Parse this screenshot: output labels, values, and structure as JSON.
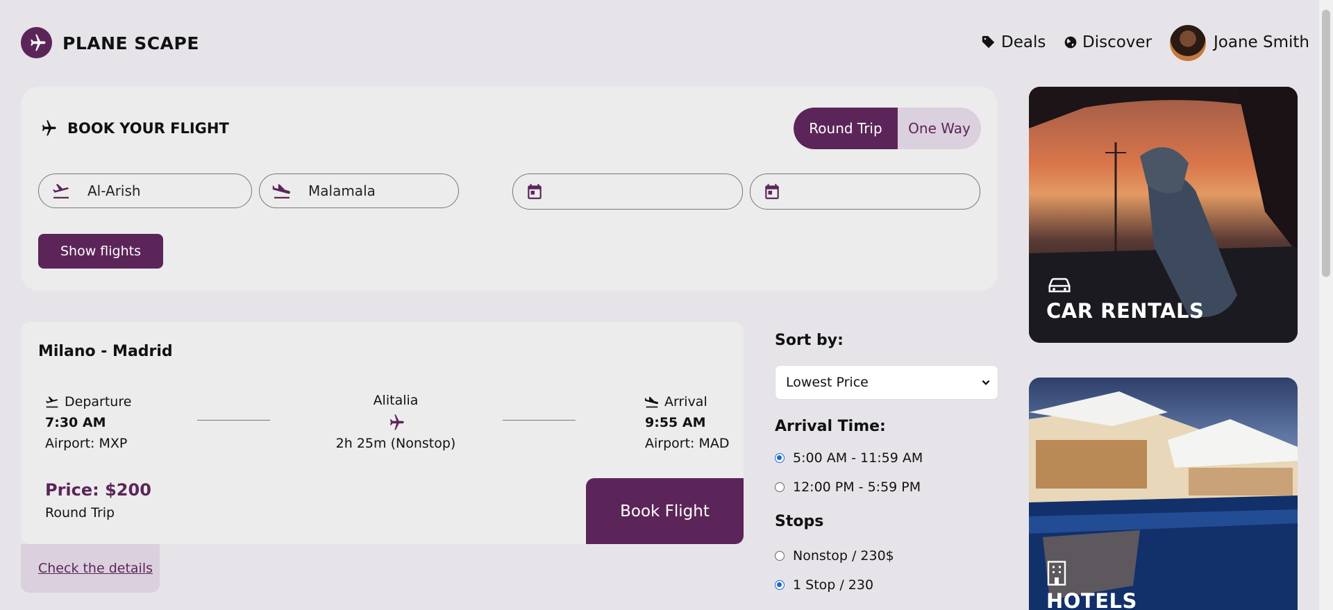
{
  "header": {
    "brand": "PLANE SCAPE",
    "nav": [
      {
        "label": "Deals",
        "icon": "tag-icon"
      },
      {
        "label": "Discover",
        "icon": "globe-icon"
      }
    ],
    "user_name": "Joane Smith"
  },
  "booking": {
    "title": "BOOK YOUR FLIGHT",
    "trip_options": [
      "Round Trip",
      "One Way"
    ],
    "selected_trip": "Round Trip",
    "from": "Al-Arish",
    "to": "Malamala",
    "depart_date": "",
    "return_date": "",
    "show_button": "Show flights"
  },
  "flight": {
    "route": "Milano - Madrid",
    "departure_label": "Departure",
    "departure_time": "7:30 AM",
    "departure_airport": "Airport: MXP",
    "airline": "Alitalia",
    "duration": "2h 25m (Nonstop)",
    "arrival_label": "Arrival",
    "arrival_time": "9:55 AM",
    "arrival_airport": "Airport: MAD",
    "price": "Price: $200",
    "trip_type": "Round Trip",
    "book_button": "Book Flight",
    "details_link": "Check the details"
  },
  "filters": {
    "sort_label": "Sort by:",
    "sort_value": "Lowest Price",
    "arrival_label": "Arrival Time:",
    "arrival_options": [
      "5:00 AM - 11:59 AM",
      "12:00 PM - 5:59 PM"
    ],
    "arrival_selected": "5:00 AM - 11:59 AM",
    "stops_label": "Stops",
    "stop_options": [
      "Nonstop / 230$",
      "1 Stop / 230"
    ],
    "stop_selected": "1 Stop / 230"
  },
  "promos": {
    "car": "CAR RENTALS",
    "hotels": "HOTELS"
  },
  "colors": {
    "accent": "#5c2559",
    "accent_light": "#dbd0dd",
    "background": "#e6e4e8",
    "card": "#ececec"
  }
}
